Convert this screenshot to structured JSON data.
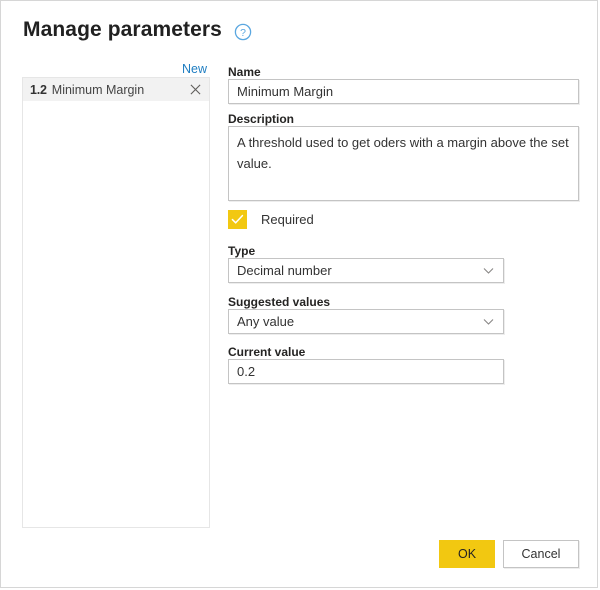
{
  "dialog": {
    "title": "Manage parameters",
    "help_icon": "help-circle-icon"
  },
  "parameter_list": {
    "new_label": "New",
    "items": [
      {
        "type_glyph": "1.2",
        "label": "Minimum Margin",
        "remove_icon": "close-icon"
      }
    ]
  },
  "form": {
    "name": {
      "label": "Name",
      "value": "Minimum Margin",
      "placeholder": ""
    },
    "description": {
      "label": "Description",
      "value": "A threshold used to get oders with a margin above the set value.",
      "placeholder": ""
    },
    "required": {
      "label": "Required",
      "checked": true,
      "check_icon": "checkmark-icon"
    },
    "type": {
      "label": "Type",
      "value": "Decimal number",
      "chevron_icon": "chevron-down-icon"
    },
    "suggested_values": {
      "label": "Suggested values",
      "value": "Any value",
      "chevron_icon": "chevron-down-icon"
    },
    "current_value": {
      "label": "Current value",
      "value": "0.2",
      "placeholder": ""
    }
  },
  "footer": {
    "ok_label": "OK",
    "cancel_label": "Cancel"
  },
  "colors": {
    "accent_yellow": "#F2C811",
    "link_blue": "#1F7EC2",
    "border_gray": "#C4C4C4",
    "selected_row": "#F2F2F2"
  }
}
